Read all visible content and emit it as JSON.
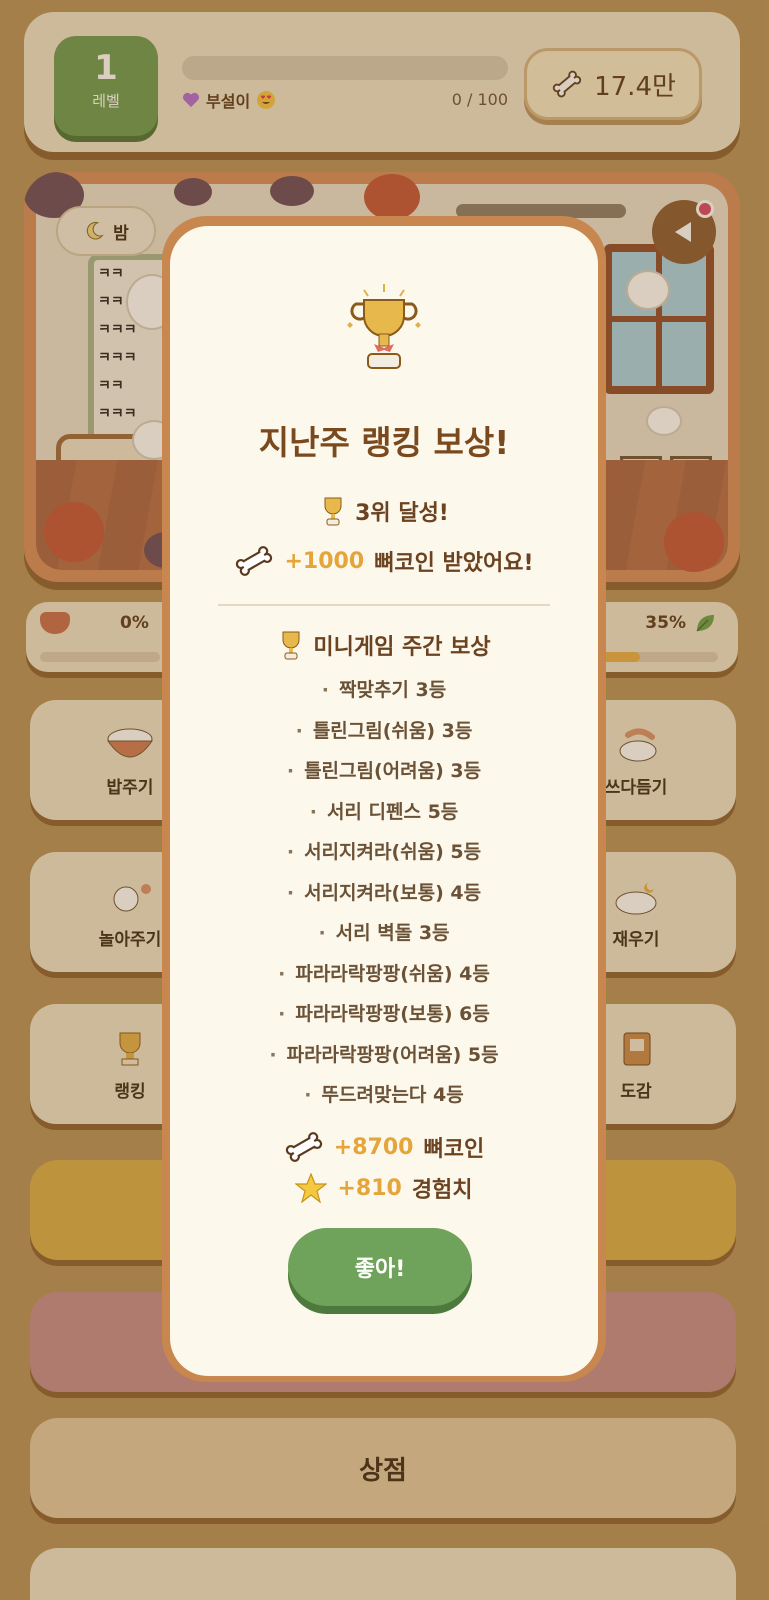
{
  "header": {
    "level_number": "1",
    "level_label": "레벨",
    "xp_progress": 0,
    "xp_text": "0 / 100",
    "pet_name": "부설이",
    "currency_value": "17.4만"
  },
  "scene": {
    "time_label": "밤",
    "window_text": [
      "ㅋㅋ",
      "ㅋㅋ",
      "ㅋㅋㅋ",
      "ㅋㅋㅋ",
      "ㅋㅋ",
      "ㅋㅋㅋ"
    ]
  },
  "stats": {
    "left_percent": "0%",
    "right_percent": "35%",
    "left_fill": 0,
    "right_fill": 0.35
  },
  "tiles": {
    "feed": "밥주기",
    "groom": "쓰다듬기",
    "play": "놀아주기",
    "sleep": "재우기",
    "ranking": "랭킹",
    "collection": "도감"
  },
  "shop_label": "상점",
  "modal": {
    "title": "지난주 랭킹 보상!",
    "rank_text": "3위 달성!",
    "reward_amount": "+1000",
    "reward_text": "뼈코인 받았어요!",
    "mini_title": "미니게임 주간 보상",
    "mini_items": [
      "짝맞추기 3등",
      "틀린그림(쉬움) 3등",
      "틀린그림(어려움) 3등",
      "서리 디펜스 5등",
      "서리지켜라(쉬움) 5등",
      "서리지켜라(보통) 4등",
      "서리 벽돌 3등",
      "파라라락팡팡(쉬움) 4등",
      "파라라락팡팡(보통) 6등",
      "파라라락팡팡(어려움) 5등",
      "뚜드려맞는다 4등"
    ],
    "total_coin_amount": "+8700",
    "total_coin_label": "뼈코인",
    "total_xp_amount": "+810",
    "total_xp_label": "경험치",
    "ok_label": "좋아!"
  },
  "colors": {
    "accent_green": "#6fa25a",
    "accent_gold": "#e5a53a",
    "background_brown": "#b8925c"
  }
}
